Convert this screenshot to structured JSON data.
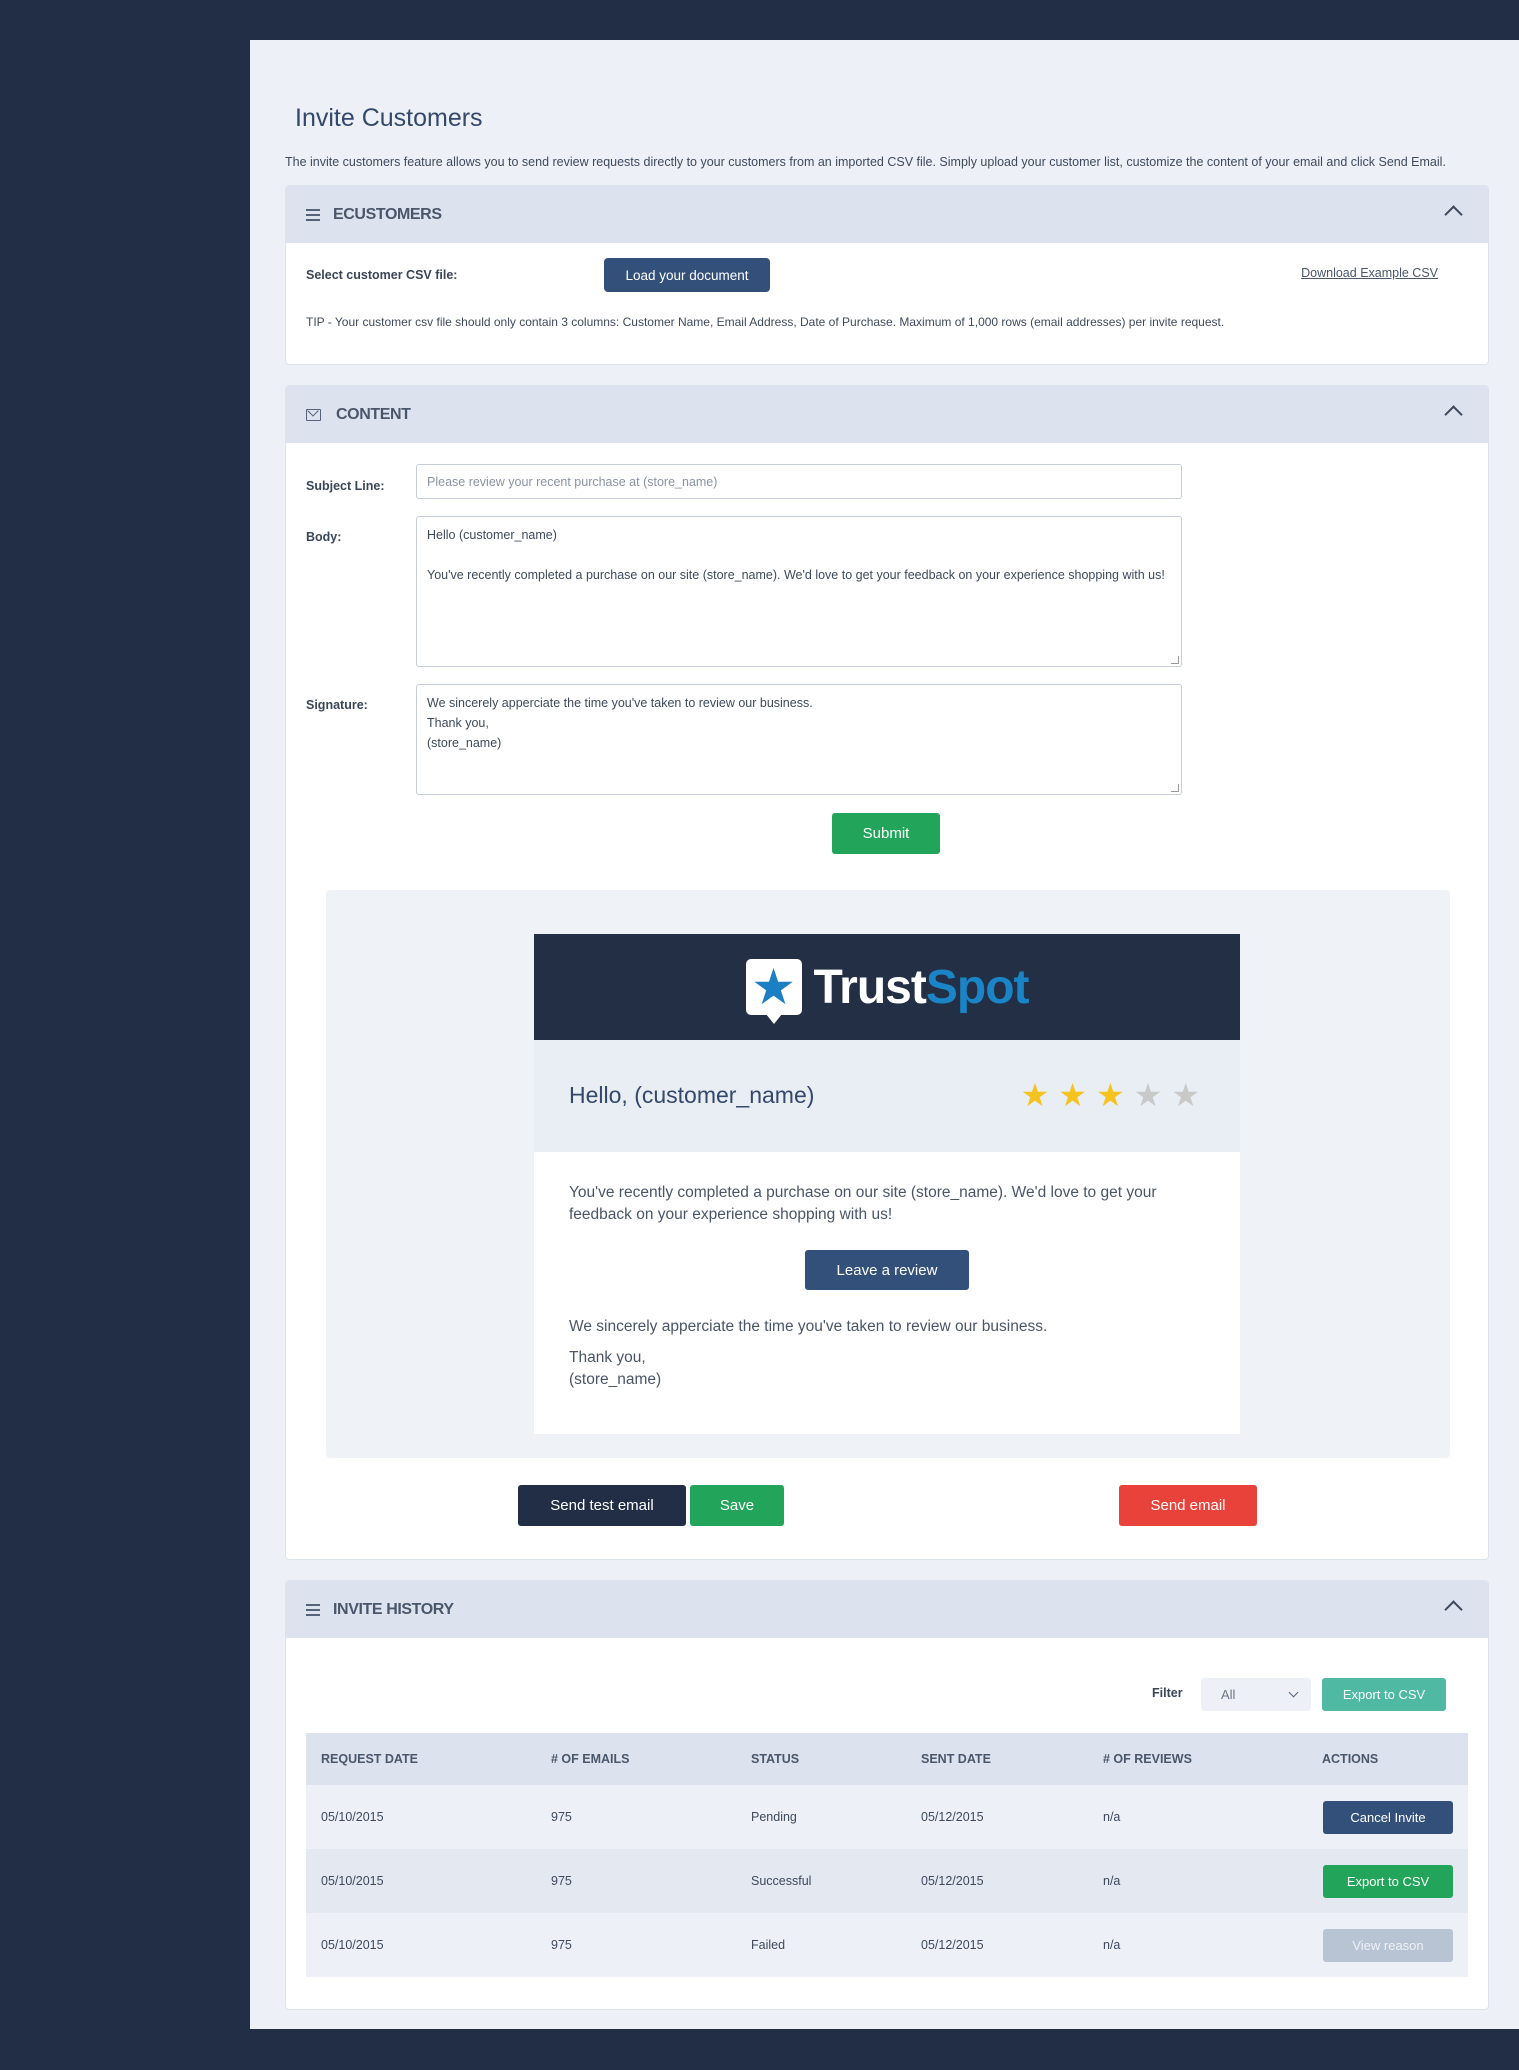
{
  "page": {
    "title": "Invite Customers",
    "description": "The invite customers feature allows you to send review requests directly to your customers from an imported CSV file. Simply upload your customer list, customize the content of your email and click Send Email."
  },
  "customers_panel": {
    "title": "ECUSTOMERS",
    "select_label": "Select customer CSV file:",
    "load_button": "Load your document",
    "download_link": "Download Example CSV",
    "tip": "TIP - Your customer csv file should only contain 3 columns: Customer Name, Email Address, Date of Purchase. Maximum of 1,000 rows (email addresses) per invite request."
  },
  "content_panel": {
    "title": "CONTENT",
    "subject_label": "Subject Line:",
    "subject_placeholder": "Please review your recent purchase at (store_name)",
    "body_label": "Body:",
    "body_value": "Hello (customer_name)\n\nYou've recently completed a purchase on our site (store_name). We'd love to get your feedback on your experience shopping with us!",
    "signature_label": "Signature:",
    "signature_value": "We sincerely apperciate the time you've taken to review our business.\nThank you,\n(store_name)",
    "submit_button": "Submit"
  },
  "preview": {
    "brand_trust": "Trust",
    "brand_spot": "Spot",
    "hello": "Hello, (customer_name)",
    "rating": 3,
    "rating_max": 5,
    "body": "You've recently completed a purchase on our site (store_name). We'd love to get your feedback on your experience shopping with us!",
    "leave_review_button": "Leave a review",
    "appreciation": "We sincerely apperciate the time you've taken to review our business.",
    "thanks": "Thank you,",
    "store": "(store_name)"
  },
  "actions": {
    "send_test": "Send test email",
    "save": "Save",
    "send": "Send email"
  },
  "history_panel": {
    "title": "INVITE HISTORY",
    "filter_label": "Filter",
    "filter_value": "All",
    "export_button": "Export to CSV",
    "columns": [
      "REQUEST DATE",
      "# OF EMAILS",
      "STATUS",
      "SENT DATE",
      "# OF REVIEWS",
      "ACTIONS"
    ],
    "rows": [
      {
        "request_date": "05/10/2015",
        "emails": "975",
        "status": "Pending",
        "sent_date": "05/12/2015",
        "reviews": "n/a",
        "action": "Cancel Invite"
      },
      {
        "request_date": "05/10/2015",
        "emails": "975",
        "status": "Successful",
        "sent_date": "05/12/2015",
        "reviews": "n/a",
        "action": "Export to CSV"
      },
      {
        "request_date": "05/10/2015",
        "emails": "975",
        "status": "Failed",
        "sent_date": "05/12/2015",
        "reviews": "n/a",
        "action": "View reason"
      }
    ]
  },
  "colors": {
    "sidebar": "#212e45",
    "page": "#edf1f7",
    "primary": "#33507a",
    "success": "#22a55a",
    "danger": "#e9423a",
    "teal": "#4fb9a4",
    "star_on": "#f5c31f",
    "star_off": "#c9c9c9"
  }
}
